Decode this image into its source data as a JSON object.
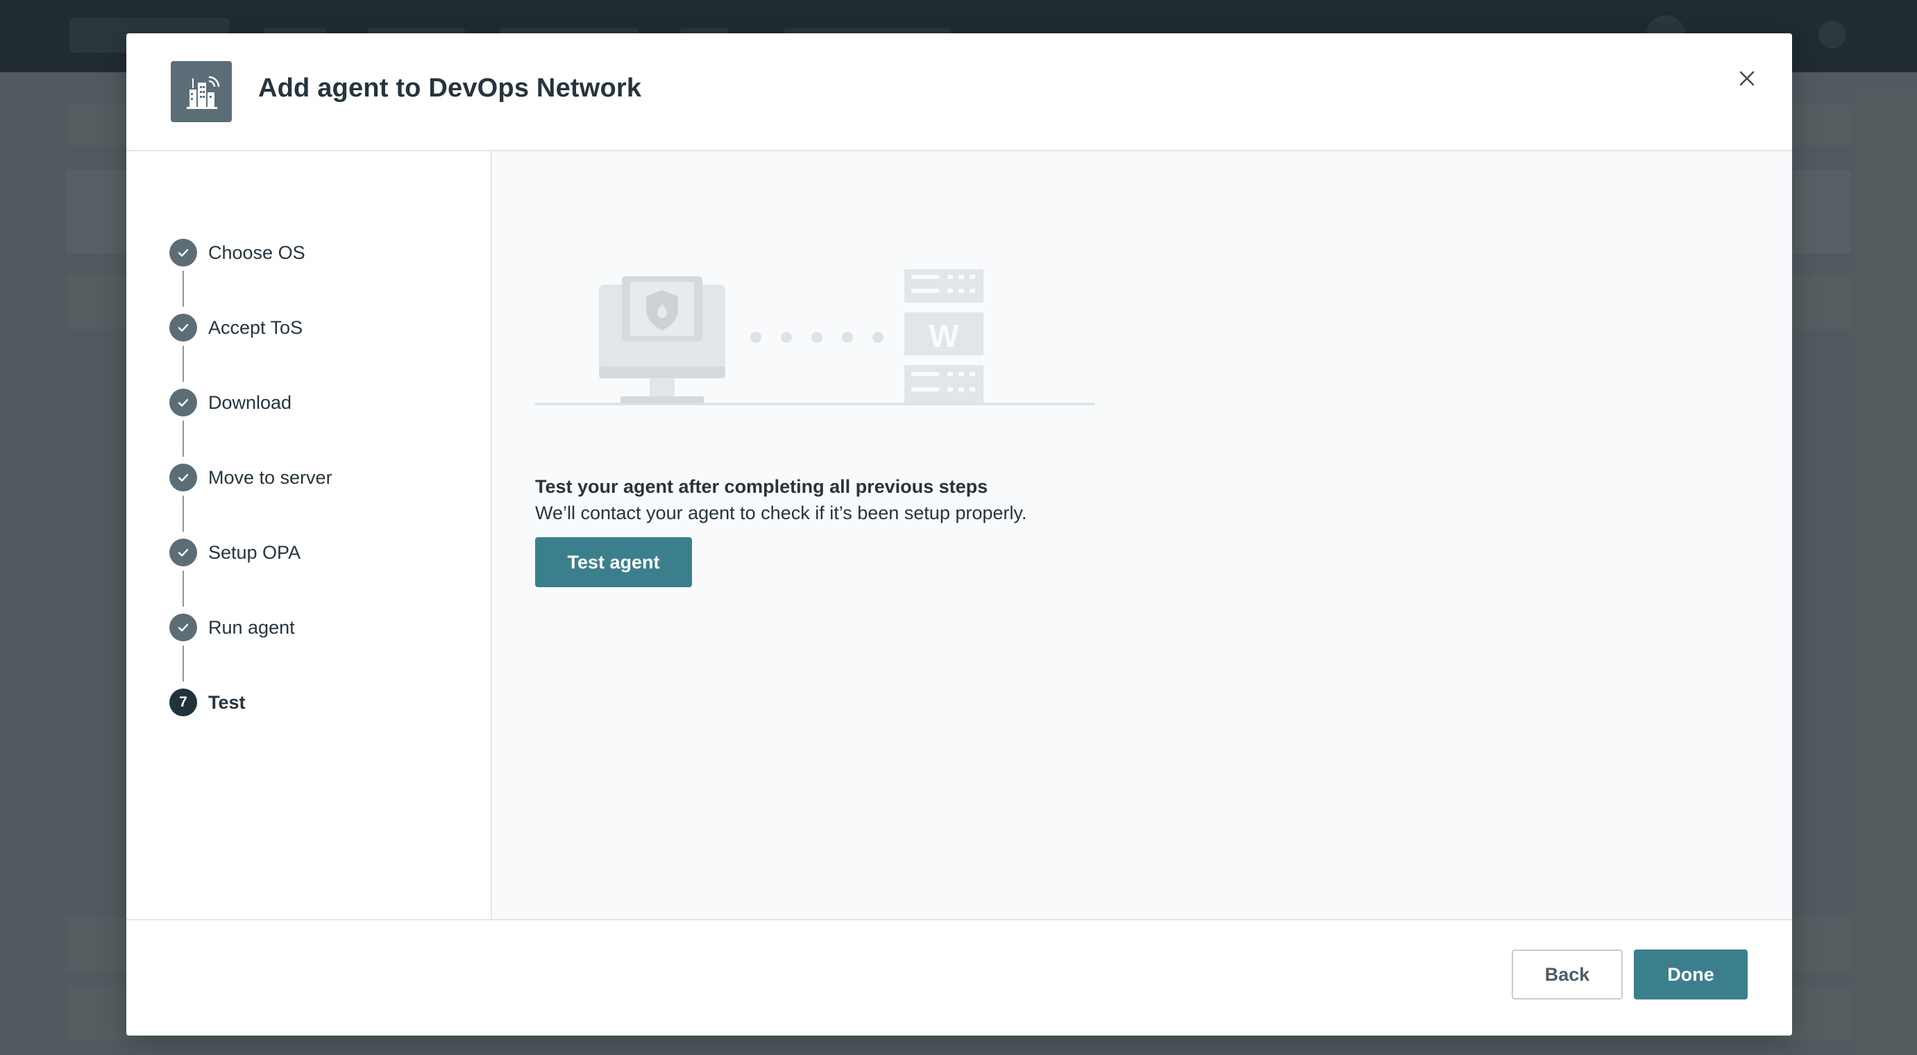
{
  "modal": {
    "title": "Add agent to DevOps Network",
    "header_icon": "building-network-icon",
    "close_icon": "close-icon"
  },
  "stepper": {
    "steps": [
      {
        "label": "Choose OS",
        "status": "completed"
      },
      {
        "label": "Accept ToS",
        "status": "completed"
      },
      {
        "label": "Download",
        "status": "completed"
      },
      {
        "label": "Move to server",
        "status": "completed"
      },
      {
        "label": "Setup OPA",
        "status": "completed"
      },
      {
        "label": "Run agent",
        "status": "completed"
      },
      {
        "label": "Test",
        "status": "current",
        "number": "7"
      }
    ]
  },
  "content": {
    "illustration": "computer-to-server-connection",
    "server_letter": "W",
    "heading": "Test your agent after completing all previous steps",
    "description": "We’ll contact your agent to check if it’s been setup properly.",
    "test_button_label": "Test agent"
  },
  "footer": {
    "back_label": "Back",
    "done_label": "Done"
  },
  "colors": {
    "primary": "#3c7f8c",
    "step_completed": "#5c6d78",
    "step_current": "#22323c",
    "text": "#26343d"
  }
}
